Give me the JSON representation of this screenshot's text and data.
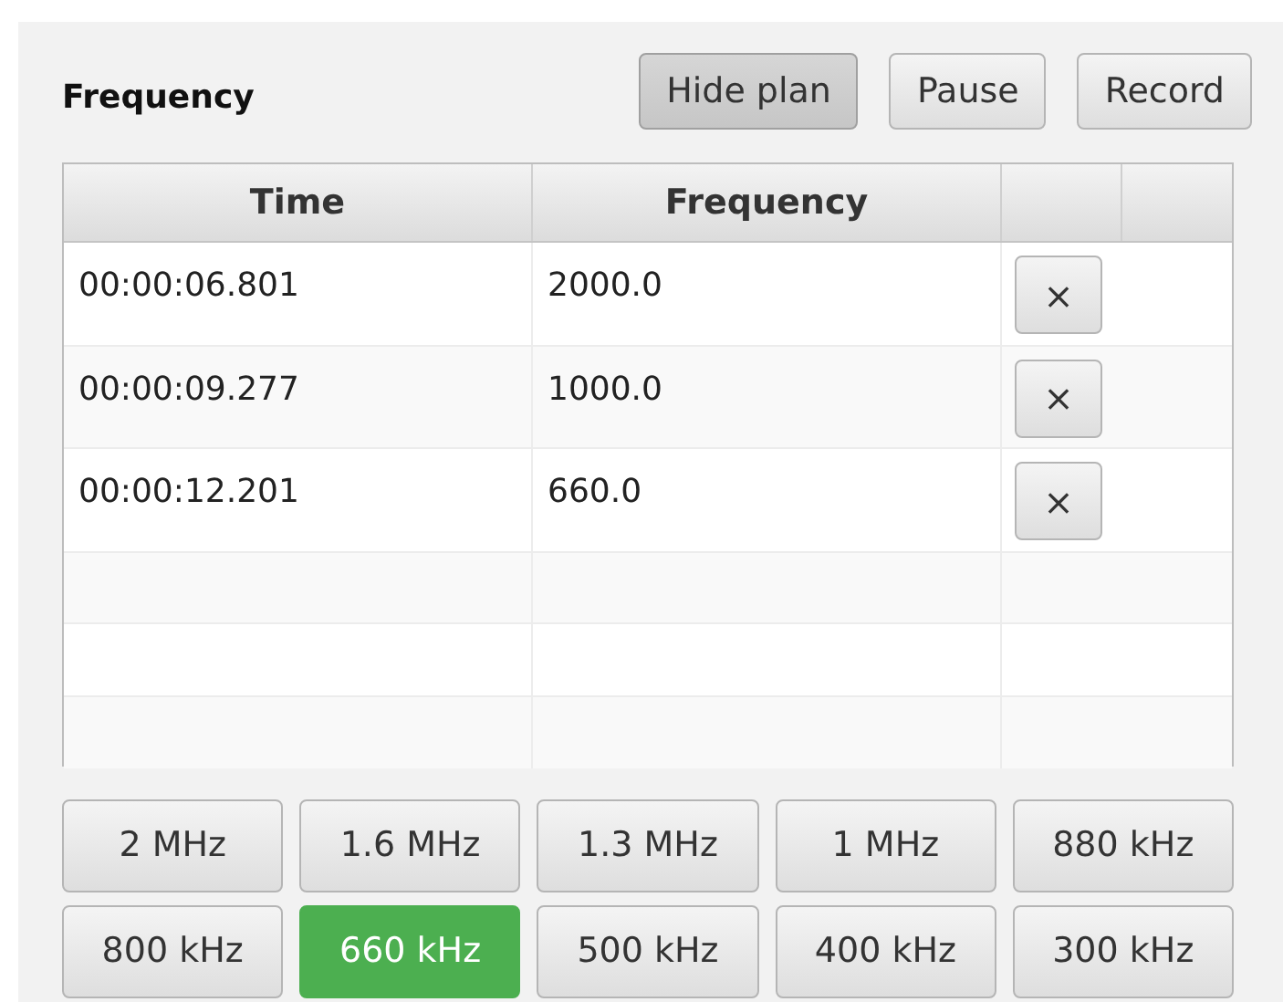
{
  "title": "Frequency",
  "actions": [
    {
      "label": "Hide plan",
      "pressed": true
    },
    {
      "label": "Pause",
      "pressed": false
    },
    {
      "label": "Record",
      "pressed": false
    }
  ],
  "table": {
    "columns": [
      "Time",
      "Frequency"
    ],
    "rows": [
      {
        "time": "00:00:06.801",
        "frequency": "2000.0",
        "delete": "×"
      },
      {
        "time": "00:00:09.277",
        "frequency": "1000.0",
        "delete": "×"
      },
      {
        "time": "00:00:12.201",
        "frequency": "660.0",
        "delete": "×"
      }
    ]
  },
  "presets": [
    {
      "label": "2 MHz",
      "selected": false
    },
    {
      "label": "1.6 MHz",
      "selected": false
    },
    {
      "label": "1.3 MHz",
      "selected": false
    },
    {
      "label": "1 MHz",
      "selected": false
    },
    {
      "label": "880 kHz",
      "selected": false
    },
    {
      "label": "800 kHz",
      "selected": false
    },
    {
      "label": "660 kHz",
      "selected": true
    },
    {
      "label": "500 kHz",
      "selected": false
    },
    {
      "label": "400 kHz",
      "selected": false
    },
    {
      "label": "300 kHz",
      "selected": false
    }
  ]
}
